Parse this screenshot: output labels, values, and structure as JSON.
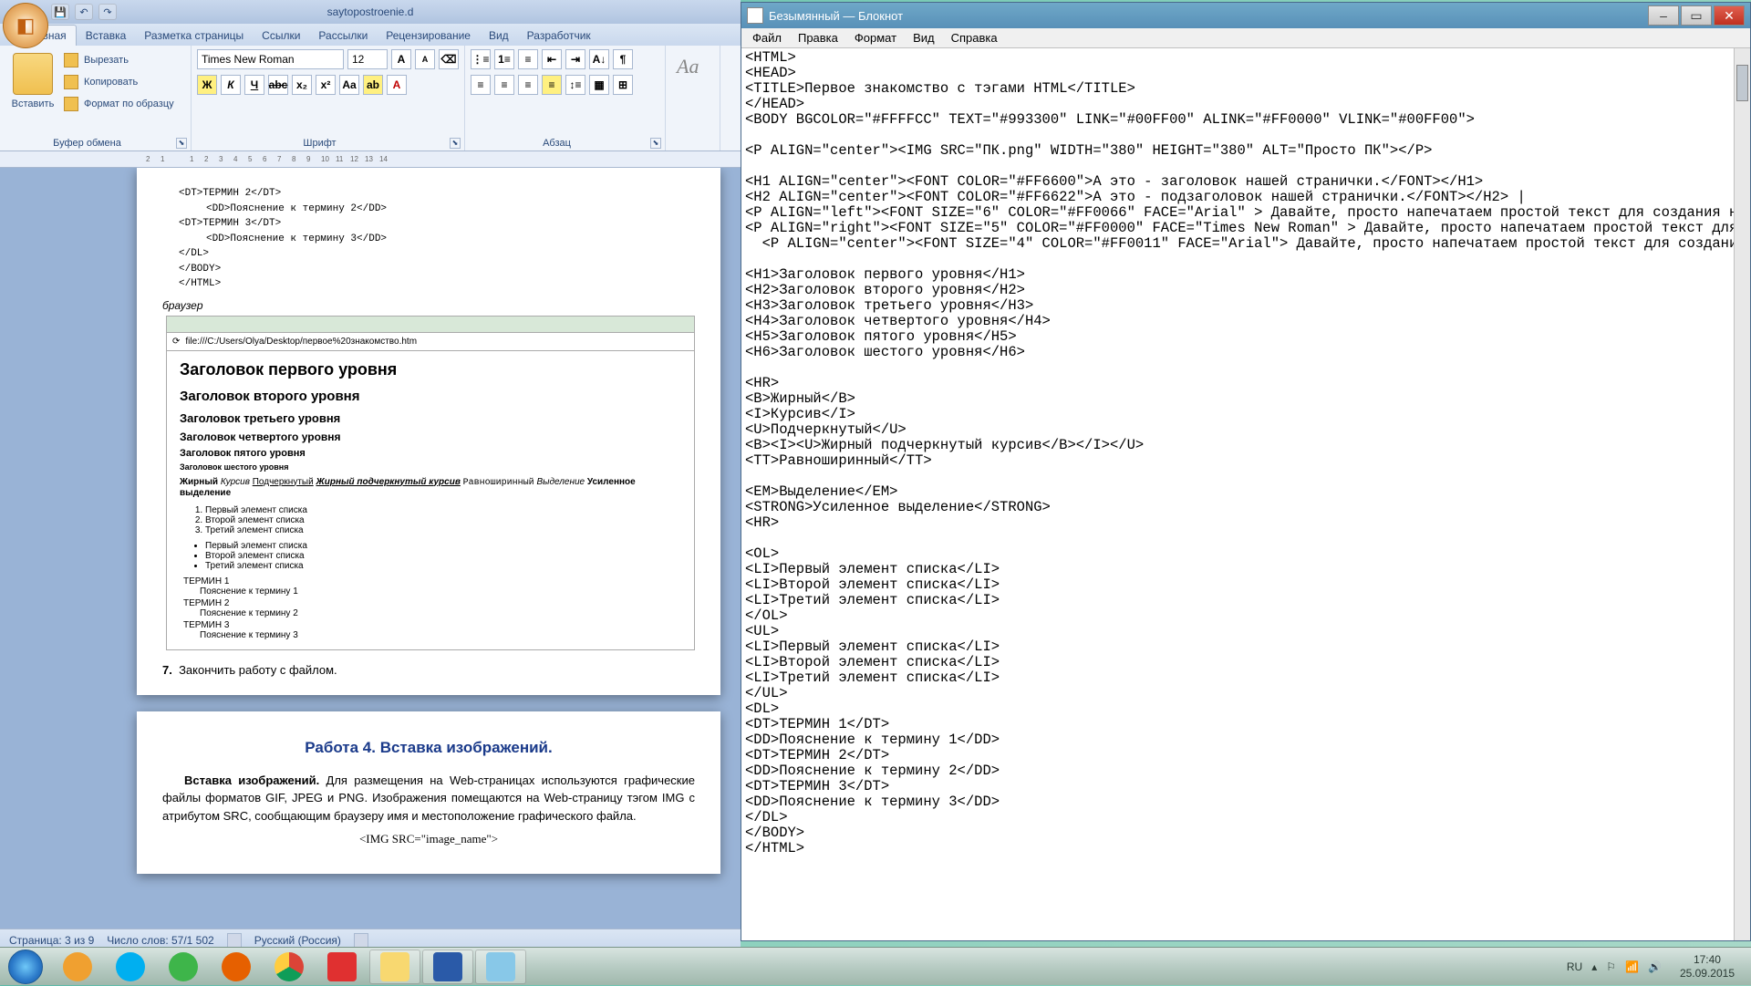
{
  "word": {
    "title": "saytopostroenie.d",
    "tabs": [
      "Главная",
      "Вставка",
      "Разметка страницы",
      "Ссылки",
      "Рассылки",
      "Рецензирование",
      "Вид",
      "Разработчик"
    ],
    "clipboard": {
      "paste": "Вставить",
      "cut": "Вырезать",
      "copy": "Копировать",
      "format": "Формат по образцу",
      "label": "Буфер обмена"
    },
    "font": {
      "name": "Times New Roman",
      "size": "12",
      "label": "Шрифт"
    },
    "paragraph": {
      "label": "Абзац"
    },
    "ruler": [
      "2",
      "1",
      "",
      "1",
      "2",
      "3",
      "4",
      "5",
      "6",
      "7",
      "8",
      "9",
      "10",
      "11",
      "12",
      "13",
      "14"
    ],
    "doc": {
      "browser_label": "браузер",
      "dl": [
        {
          "t": "<DT>ТЕРМИН 2</DT>",
          "d": "<DD>Пояснение к термину 2</DD>"
        },
        {
          "t": "<DT>ТЕРМИН 3</DT>",
          "d": "<DD>Пояснение к термину 3</DD>"
        }
      ],
      "close": [
        "</DL>",
        "",
        "</BODY>",
        "</HTML>"
      ],
      "addr": "file:///C:/Users/Olya/Desktop/первое%20знакомство.htm",
      "h1": "Заголовок первого уровня",
      "h2": "Заголовок второго уровня",
      "h3": "Заголовок третьего уровня",
      "h4": "Заголовок четвертого уровня",
      "h5": "Заголовок пятого уровня",
      "h6": "Заголовок шестого уровня",
      "fmt": {
        "b": "Жирный",
        "i": "Курсив",
        "u": "Подчеркнутый",
        "biu": "Жирный подчеркнутый курсив",
        "tt": "Равноширинный",
        "em": "Выделение",
        "str": "Усиленное выделение"
      },
      "ol": [
        "Первый элемент списка",
        "Второй элемент списка",
        "Третий элемент списка"
      ],
      "ul": [
        "Первый элемент списка",
        "Второй элемент списка",
        "Третий элемент списка"
      ],
      "dl2": [
        {
          "t": "ТЕРМИН 1",
          "d": "Пояснение к термину 1"
        },
        {
          "t": "ТЕРМИН 2",
          "d": "Пояснение к термину 2"
        },
        {
          "t": "ТЕРМИН 3",
          "d": "Пояснение к термину 3"
        }
      ],
      "step7num": "7.",
      "step7": "Закончить работу с файлом.",
      "work4": "Работа 4. Вставка изображений.",
      "img_head": "Вставка изображений.",
      "img_txt": " Для размещения на Web-страницах используются графические файлы форматов GIF, JPEG и PNG. Изображения помещаются на Web-страницу тэгом IMG с атрибутом SRC, сообщающим браузеру имя и местоположение графического файла.",
      "img_code": "<IMG SRC=\"image_name\">"
    },
    "status": {
      "page": "Страница: 3 из 9",
      "words": "Число слов: 57/1 502",
      "lang": "Русский (Россия)"
    }
  },
  "notepad": {
    "title": "Безымянный — Блокнот",
    "menu": [
      "Файл",
      "Правка",
      "Формат",
      "Вид",
      "Справка"
    ],
    "text": "<HTML>\n<HEAD>\n<TITLE>Первое знакомство с тэгами HTML</TITLE>\n</HEAD>\n<BODY BGCOLOR=\"#FFFFCC\" TEXT=\"#993300\" LINK=\"#00FF00\" ALINK=\"#FF0000\" VLINK=\"#00FF00\">\n\n<P ALIGN=\"center\"><IMG SRC=\"ПК.png\" WIDTH=\"380\" HEIGHT=\"380\" ALT=\"Просто ПК\"></P>\n\n<H1 ALIGN=\"center\"><FONT COLOR=\"#FF6600\">А это - заголовок нашей странички.</FONT></H1>\n<H2 ALIGN=\"center\"><FONT COLOR=\"#FF6622\">А это - подзаголовок нашей странички.</FONT></H2> |\n<P ALIGN=\"left\"><FONT SIZE=\"6\" COLOR=\"#FF0066\" FACE=\"Arial\" > Давайте, просто напечатаем простой текст для создания нашей странички, выровненный по левому краю.</FONT></P>\n<P ALIGN=\"right\"><FONT SIZE=\"5\" COLOR=\"#FF0000\" FACE=\"Times New Roman\" > Давайте, просто напечатаем простой текст для создания нашей странички, выровненный по правому краю.</FONT></P>\n  <P ALIGN=\"center\"><FONT SIZE=\"4\" COLOR=\"#FF0011\" FACE=\"Arial\"> Давайте, просто напечатаем простой текст для создания нашей странички, выровненный по центру.</FONT></P>\n\n<H1>Заголовок первого уровня</H1>\n<H2>Заголовок второго уровня</H2>\n<H3>Заголовок третьего уровня</H3>\n<H4>Заголовок четвертого уровня</H4>\n<H5>Заголовок пятого уровня</H5>\n<H6>Заголовок шестого уровня</H6>\n\n<HR>\n<B>Жирный</B>\n<I>Курсив</I>\n<U>Подчеркнутый</U>\n<B><I><U>Жирный подчеркнутый курсив</B></I></U>\n<TT>Равноширинный</TT>\n\n<EM>Выделение</EM>\n<STRONG>Усиленное выделение</STRONG>\n<HR>\n\n<OL>\n<LI>Первый элемент списка</LI>\n<LI>Второй элемент списка</LI>\n<LI>Третий элемент списка</LI>\n</OL>\n<UL>\n<LI>Первый элемент списка</LI>\n<LI>Второй элемент списка</LI>\n<LI>Третий элемент списка</LI>\n</UL>\n<DL>\n<DT>ТЕРМИН 1</DT>\n<DD>Пояснение к термину 1</DD>\n<DT>ТЕРМИН 2</DT>\n<DD>Пояснение к термину 2</DD>\n<DT>ТЕРМИН 3</DT>\n<DD>Пояснение к термину 3</DD>\n</DL>\n</BODY>\n</HTML>"
  },
  "taskbar": {
    "lang": "RU",
    "time": "17:40",
    "date": "25.09.2015",
    "apps": [
      "media-player",
      "skype",
      "utorrent",
      "firefox",
      "chrome",
      "ccleaner",
      "explorer",
      "word",
      "notepad"
    ]
  },
  "colors": {
    "skype": "#00aff0",
    "utorrent": "#3eb54a",
    "firefox": "#e66000",
    "chrome": "#ffffff",
    "ccleaner": "#e03030",
    "explorer": "#f8d870",
    "word": "#2a5aa8",
    "notepad": "#88c8e8",
    "media": "#f0a030"
  }
}
